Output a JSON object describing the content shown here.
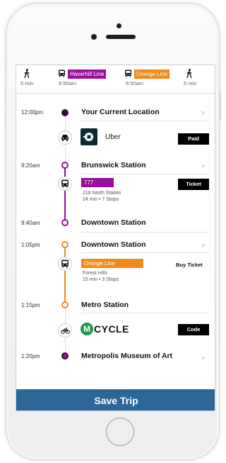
{
  "summary": {
    "walk_start": "5 min",
    "leg1_line": "Haverhill Line",
    "leg1_time": "8:50am",
    "leg2_line": "Orange Line",
    "leg2_time": "8:50am",
    "walk_end": "5 min"
  },
  "colors": {
    "purple": "#9a0f9a",
    "orange": "#f08a1c",
    "save_bar": "#2d6699"
  },
  "timeline": {
    "current": {
      "time": "12:00pm",
      "title": "Your Current Location"
    },
    "uber": {
      "label": "Uber",
      "action": "Paid"
    },
    "brunswick": {
      "time": "9:20am",
      "title": "Brunswick Station"
    },
    "bus": {
      "route": "777",
      "detail1": "218 North Station",
      "detail2": "24 min • 7 Stops",
      "action": "Ticket"
    },
    "downtown_arrive": {
      "time": "9:40am",
      "title": "Downtown Station"
    },
    "downtown_depart": {
      "time": "1:05pm",
      "title": "Downtown Station"
    },
    "orange": {
      "route": "Orange Line",
      "detail1": "Forest Hills",
      "detail2": "15 min • 3 Stops",
      "action": "Buy Ticket"
    },
    "metro": {
      "time": "1:15pm",
      "title": "Metro Station"
    },
    "bike": {
      "brand_letter": "M",
      "brand_rest": "CYCLE",
      "action": "Code"
    },
    "museum": {
      "time": "1:20pm",
      "title": "Metropolis Museum of Art"
    }
  },
  "save_button": "Save Trip",
  "chevron": ">"
}
